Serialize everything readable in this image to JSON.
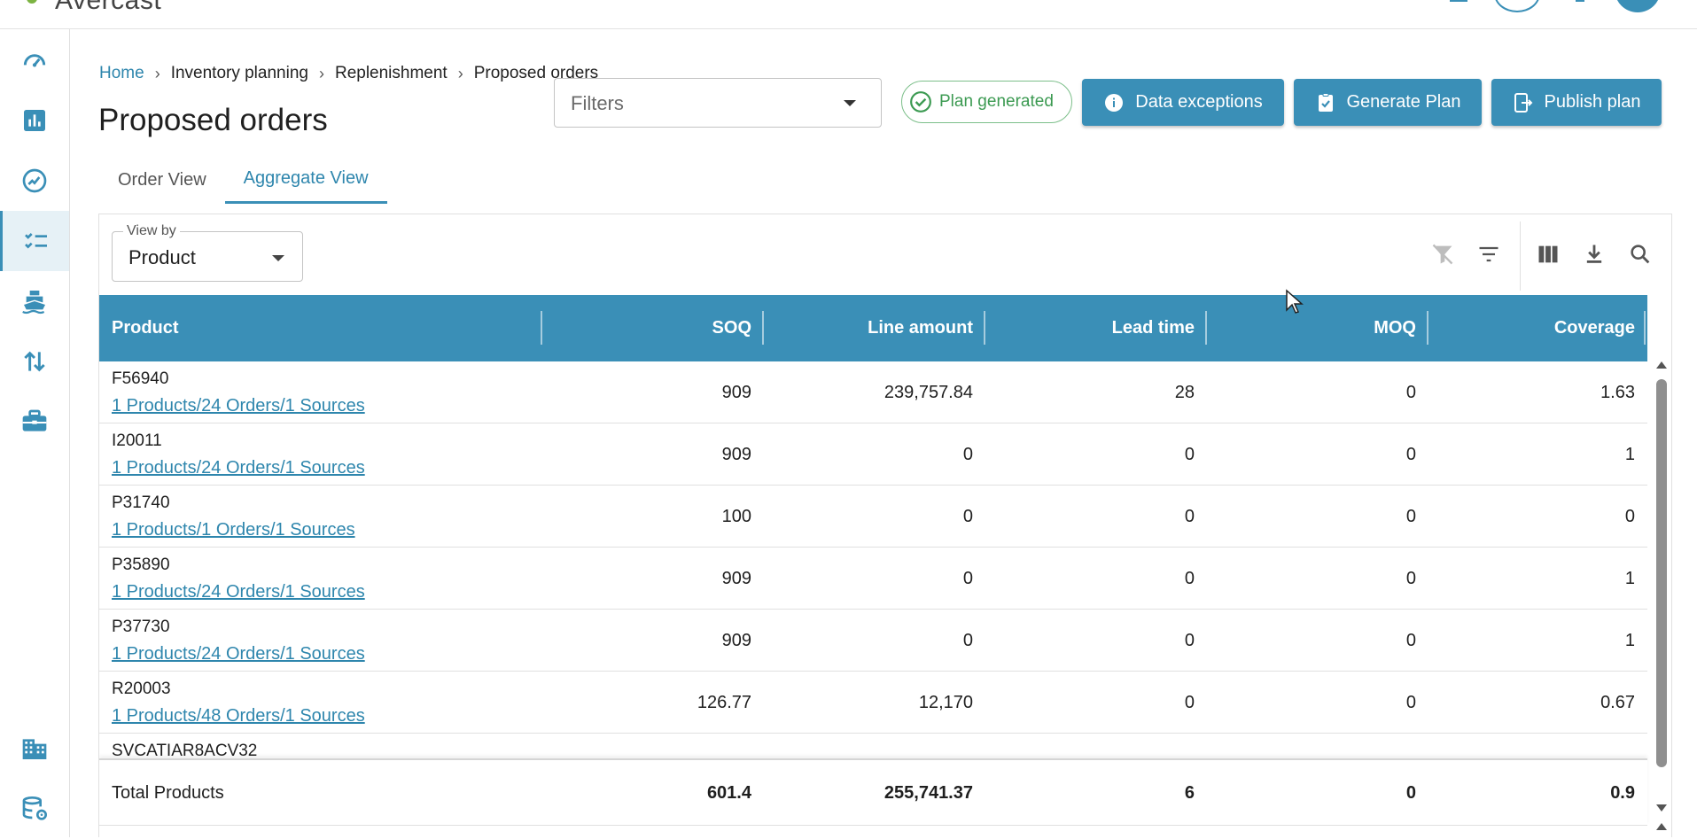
{
  "app": {
    "brand": "Avercast"
  },
  "breadcrumb": [
    "Home",
    "Inventory planning",
    "Replenishment",
    "Proposed orders"
  ],
  "page_title": "Proposed orders",
  "filters": {
    "placeholder": "Filters"
  },
  "status_badge": "Plan generated",
  "actions": {
    "data_exceptions": "Data exceptions",
    "generate_plan": "Generate Plan",
    "publish_plan": "Publish plan"
  },
  "tabs": [
    "Order View",
    "Aggregate View"
  ],
  "active_tab": "Aggregate View",
  "view_by": {
    "label": "View by",
    "value": "Product"
  },
  "table": {
    "columns": [
      "Product",
      "SOQ",
      "Line amount",
      "Lead time",
      "MOQ",
      "Coverage"
    ],
    "rows": [
      {
        "product": "F56940",
        "link": "1 Products/24 Orders/1 Sources",
        "soq": "909",
        "line_amount": "239,757.84",
        "lead_time": "28",
        "moq": "0",
        "coverage": "1.63"
      },
      {
        "product": "I20011",
        "link": "1 Products/24 Orders/1 Sources",
        "soq": "909",
        "line_amount": "0",
        "lead_time": "0",
        "moq": "0",
        "coverage": "1"
      },
      {
        "product": "P31740",
        "link": "1 Products/1 Orders/1 Sources",
        "soq": "100",
        "line_amount": "0",
        "lead_time": "0",
        "moq": "0",
        "coverage": "0"
      },
      {
        "product": "P35890",
        "link": "1 Products/24 Orders/1 Sources",
        "soq": "909",
        "line_amount": "0",
        "lead_time": "0",
        "moq": "0",
        "coverage": "1"
      },
      {
        "product": "P37730",
        "link": "1 Products/24 Orders/1 Sources",
        "soq": "909",
        "line_amount": "0",
        "lead_time": "0",
        "moq": "0",
        "coverage": "1"
      },
      {
        "product": "R20003",
        "link": "1 Products/48 Orders/1 Sources",
        "soq": "126.77",
        "line_amount": "12,170",
        "lead_time": "0",
        "moq": "0",
        "coverage": "0.67"
      },
      {
        "product": "SVCATIAR8ACV32",
        "link": "",
        "soq": "",
        "line_amount": "",
        "lead_time": "",
        "moq": "",
        "coverage": ""
      }
    ],
    "total": {
      "label": "Total Products",
      "soq": "601.4",
      "line_amount": "255,741.37",
      "lead_time": "6",
      "moq": "0",
      "coverage": "0.9"
    }
  },
  "sidebar": [
    "dashboard-icon",
    "bar-chart-icon",
    "trend-icon",
    "checklist-icon",
    "ship-icon",
    "swap-arrows-icon",
    "briefcase-icon",
    "building-icon",
    "database-settings-icon"
  ],
  "colors": {
    "accent": "#3a8fb7",
    "success": "#3c9a52",
    "link": "#2e86ad"
  }
}
